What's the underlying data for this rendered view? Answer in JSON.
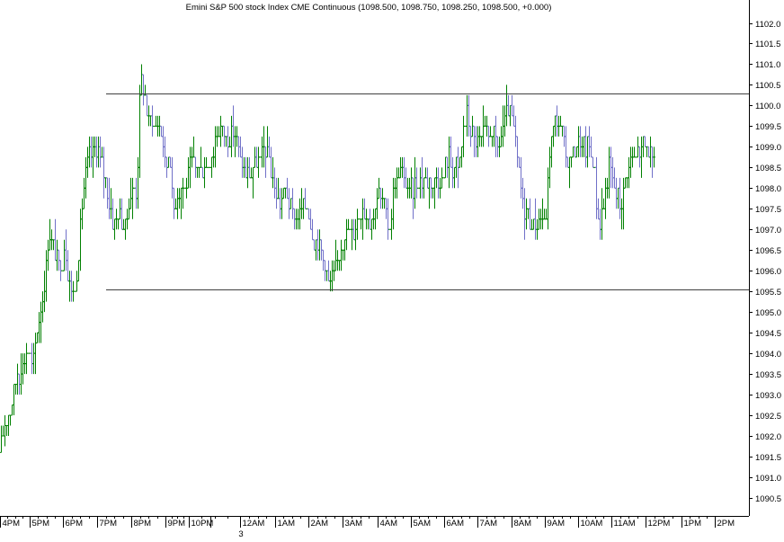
{
  "chart_data": {
    "type": "bar",
    "title": "Emini S&P 500 stock Index CME Continuous (1098.500, 1098.750, 1098.250, 1098.500, +0.000)",
    "ylim": [
      1090.0,
      1102.5
    ],
    "yticks": [
      1102.0,
      1101.5,
      1101.0,
      1100.5,
      1100.0,
      1099.5,
      1099.0,
      1098.5,
      1098.0,
      1097.5,
      1097.0,
      1096.5,
      1096.0,
      1095.5,
      1095.0,
      1094.5,
      1094.0,
      1093.5,
      1093.0,
      1092.5,
      1092.0,
      1091.5,
      1091.0,
      1090.5
    ],
    "ytick_labels": [
      "1102.0",
      "1101.5",
      "1101.0",
      "1100.5",
      "1100.0",
      "1099.5",
      "1099.0",
      "1098.5",
      "1098.0",
      "1097.5",
      "1097.0",
      "1096.5",
      "1096.0",
      "1095.5",
      "1095.0",
      "1094.5",
      "1094.0",
      "1093.5",
      "1093.0",
      "1092.5",
      "1092.0",
      "1091.5",
      "1091.0",
      "1090.5"
    ],
    "xticks": [
      "4PM",
      "5PM",
      "6PM",
      "7PM",
      "8PM",
      "9PM",
      "10PM",
      "12AM",
      "1AM",
      "2AM",
      "3AM",
      "4AM",
      "5AM",
      "6AM",
      "7AM",
      "8AM",
      "9AM",
      "10AM",
      "11AM",
      "12PM",
      "1PM",
      "2PM"
    ],
    "date_marker": "3",
    "hlines": [
      1100.3,
      1095.55
    ],
    "colors": {
      "up": "#008000",
      "down": "#7070c8",
      "grid": "#000000",
      "hline": "#404040"
    },
    "waypoints": [
      [
        0,
        1091.6
      ],
      [
        6,
        1092.4
      ],
      [
        12,
        1092.7
      ],
      [
        18,
        1093.4
      ],
      [
        24,
        1093.7
      ],
      [
        30,
        1094.2
      ],
      [
        36,
        1093.6
      ],
      [
        42,
        1094.8
      ],
      [
        48,
        1095.5
      ],
      [
        54,
        1096.9
      ],
      [
        60,
        1096.4
      ],
      [
        66,
        1096.0
      ],
      [
        72,
        1096.6
      ],
      [
        78,
        1095.5
      ],
      [
        84,
        1095.6
      ],
      [
        90,
        1097.3
      ],
      [
        96,
        1098.7
      ],
      [
        102,
        1098.7
      ],
      [
        108,
        1099.0
      ],
      [
        114,
        1098.5
      ],
      [
        120,
        1097.8
      ],
      [
        126,
        1097.0
      ],
      [
        132,
        1097.5
      ],
      [
        138,
        1097.0
      ],
      [
        144,
        1097.7
      ],
      [
        148,
        1097.9
      ],
      [
        152,
        1098.0
      ],
      [
        156,
        1100.6
      ],
      [
        160,
        1100.3
      ],
      [
        164,
        1099.6
      ],
      [
        168,
        1099.8
      ],
      [
        172,
        1099.5
      ],
      [
        176,
        1099.5
      ],
      [
        180,
        1099.3
      ],
      [
        184,
        1098.4
      ],
      [
        188,
        1099.0
      ],
      [
        192,
        1097.5
      ],
      [
        196,
        1097.8
      ],
      [
        200,
        1098.0
      ],
      [
        206,
        1098.0
      ],
      [
        212,
        1098.7
      ],
      [
        218,
        1098.5
      ],
      [
        224,
        1098.5
      ],
      [
        230,
        1098.6
      ],
      [
        236,
        1098.8
      ],
      [
        240,
        1099.4
      ],
      [
        246,
        1099.5
      ],
      [
        252,
        1099.2
      ],
      [
        258,
        1099.3
      ],
      [
        264,
        1099.1
      ],
      [
        270,
        1098.4
      ],
      [
        276,
        1098.3
      ],
      [
        282,
        1098.5
      ],
      [
        288,
        1098.7
      ],
      [
        294,
        1098.9
      ],
      [
        300,
        1098.6
      ],
      [
        306,
        1097.8
      ],
      [
        312,
        1097.7
      ],
      [
        318,
        1097.9
      ],
      [
        324,
        1097.5
      ],
      [
        330,
        1097.2
      ],
      [
        336,
        1097.5
      ],
      [
        342,
        1097.6
      ],
      [
        348,
        1096.8
      ],
      [
        354,
        1096.6
      ],
      [
        360,
        1096.3
      ],
      [
        366,
        1095.6
      ],
      [
        372,
        1096.0
      ],
      [
        378,
        1096.6
      ],
      [
        384,
        1097.0
      ],
      [
        390,
        1096.8
      ],
      [
        396,
        1097.2
      ],
      [
        402,
        1097.6
      ],
      [
        408,
        1097.4
      ],
      [
        414,
        1097.2
      ],
      [
        420,
        1097.9
      ],
      [
        426,
        1097.6
      ],
      [
        432,
        1096.9
      ],
      [
        438,
        1098.0
      ],
      [
        444,
        1098.5
      ],
      [
        450,
        1098.1
      ],
      [
        456,
        1097.9
      ],
      [
        462,
        1098.1
      ],
      [
        468,
        1098.2
      ],
      [
        474,
        1098.3
      ],
      [
        480,
        1098.0
      ],
      [
        486,
        1098.2
      ],
      [
        492,
        1098.2
      ],
      [
        498,
        1098.8
      ],
      [
        504,
        1098.4
      ],
      [
        510,
        1098.5
      ],
      [
        516,
        1099.6
      ],
      [
        520,
        1099.8
      ],
      [
        524,
        1099.4
      ],
      [
        530,
        1099.0
      ],
      [
        536,
        1099.3
      ],
      [
        542,
        1099.3
      ],
      [
        548,
        1099.5
      ],
      [
        552,
        1098.9
      ],
      [
        558,
        1099.4
      ],
      [
        564,
        1099.8
      ],
      [
        570,
        1099.6
      ],
      [
        576,
        1098.5
      ],
      [
        582,
        1097.5
      ],
      [
        588,
        1097.3
      ],
      [
        594,
        1097.0
      ],
      [
        600,
        1097.4
      ],
      [
        606,
        1097.0
      ],
      [
        612,
        1099.2
      ],
      [
        618,
        1099.7
      ],
      [
        624,
        1099.4
      ],
      [
        630,
        1098.6
      ],
      [
        636,
        1098.8
      ],
      [
        642,
        1099.1
      ],
      [
        648,
        1099.0
      ],
      [
        654,
        1099.0
      ],
      [
        660,
        1098.5
      ],
      [
        666,
        1097.0
      ],
      [
        672,
        1097.8
      ],
      [
        678,
        1098.6
      ],
      [
        684,
        1097.9
      ],
      [
        690,
        1097.6
      ],
      [
        696,
        1098.3
      ],
      [
        702,
        1098.7
      ],
      [
        708,
        1098.8
      ],
      [
        714,
        1099.0
      ],
      [
        720,
        1099.1
      ],
      [
        726,
        1098.5
      ]
    ]
  }
}
